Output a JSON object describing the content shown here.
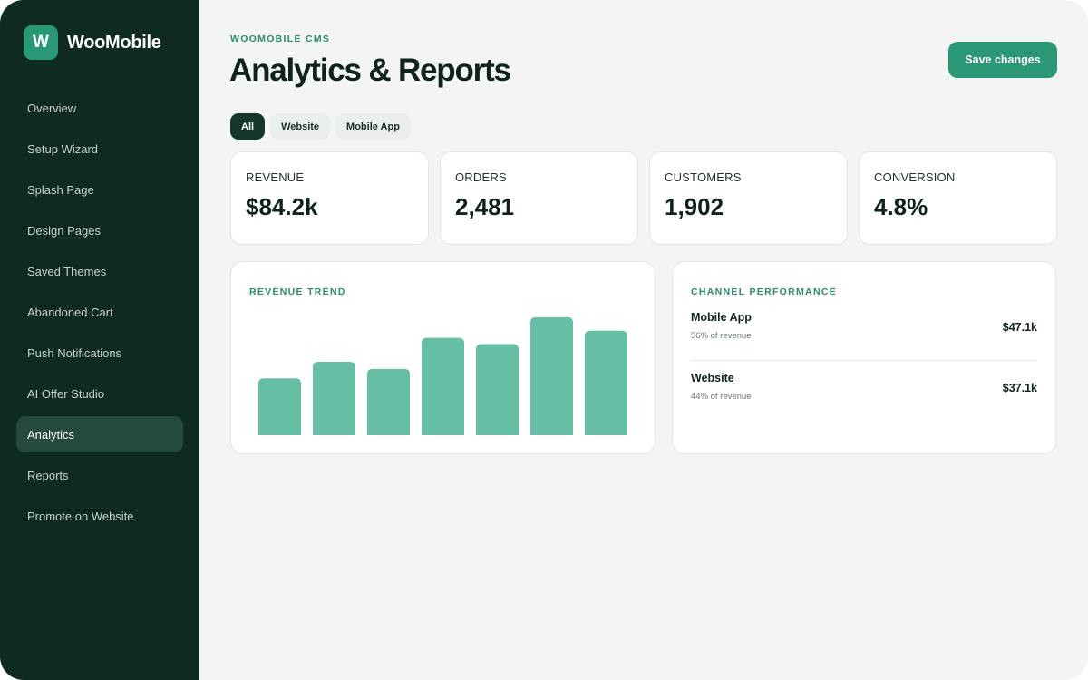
{
  "brand": {
    "logo_letter": "W",
    "name": "WooMobile"
  },
  "sidebar": {
    "items": [
      {
        "label": "Overview"
      },
      {
        "label": "Setup Wizard"
      },
      {
        "label": "Splash Page"
      },
      {
        "label": "Design Pages"
      },
      {
        "label": "Saved Themes"
      },
      {
        "label": "Abandoned Cart"
      },
      {
        "label": "Push Notifications"
      },
      {
        "label": "AI Offer Studio"
      },
      {
        "label": "Analytics",
        "active": true
      },
      {
        "label": "Reports"
      },
      {
        "label": "Promote on Website"
      }
    ]
  },
  "header": {
    "eyebrow": "WOOMOBILE CMS",
    "title": "Analytics & Reports",
    "save_label": "Save changes"
  },
  "tabs": [
    {
      "label": "All",
      "active": true
    },
    {
      "label": "Website"
    },
    {
      "label": "Mobile App"
    }
  ],
  "stats": [
    {
      "label": "REVENUE",
      "value": "$84.2k"
    },
    {
      "label": "ORDERS",
      "value": "2,481"
    },
    {
      "label": "CUSTOMERS",
      "value": "1,902"
    },
    {
      "label": "CONVERSION",
      "value": "4.8%"
    }
  ],
  "revenue_trend": {
    "title": "REVENUE TREND"
  },
  "chart_data": {
    "type": "bar",
    "title": "REVENUE TREND",
    "categories": [
      "",
      "",
      "",
      "",
      "",
      "",
      ""
    ],
    "values": [
      55,
      71,
      64,
      94,
      88,
      114,
      101
    ],
    "ylim": [
      0,
      120
    ],
    "grid": false,
    "bar_color": "#66bea4"
  },
  "channel": {
    "title": "CHANNEL PERFORMANCE",
    "rows": [
      {
        "name": "Mobile App",
        "share": "56% of revenue",
        "amount": "$47.1k"
      },
      {
        "name": "Website",
        "share": "44% of revenue",
        "amount": "$37.1k"
      }
    ]
  },
  "colors": {
    "sidebar_bg": "#0e2a22",
    "accent": "#2a9877",
    "accent_text": "#2a8a6c",
    "bar": "#66bea4"
  }
}
